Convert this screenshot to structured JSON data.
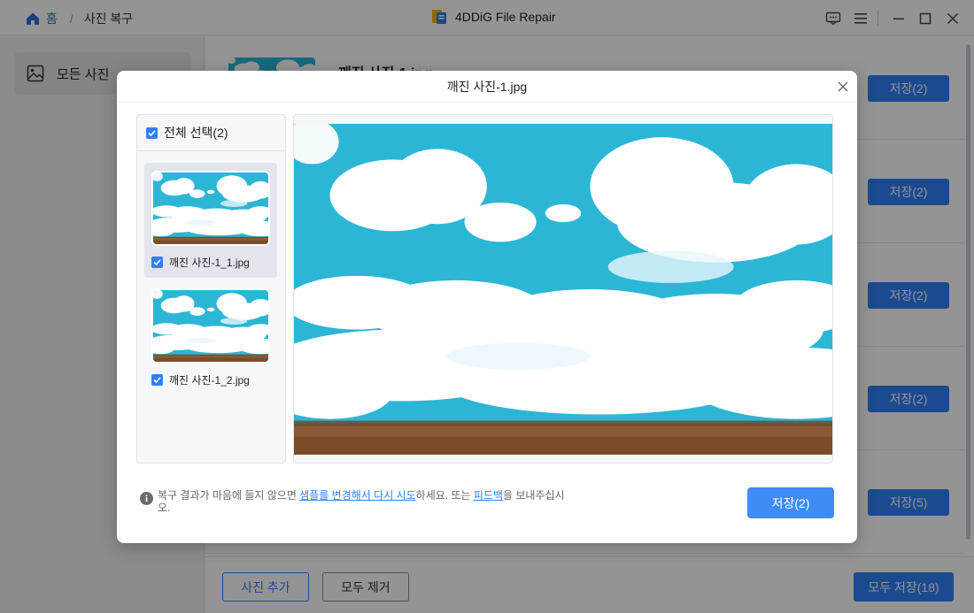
{
  "titlebar": {
    "home_label": "홈",
    "breadcrumb_current": "사진 복구",
    "app_title": "4DDiG File Repair"
  },
  "sidebar": {
    "items": [
      {
        "label": "모든 사진",
        "icon": "image-icon"
      }
    ]
  },
  "background_list": {
    "first_file_name": "깨진 사진-1.jpg",
    "save_buttons": [
      "저장(2)",
      "저장(2)",
      "저장(2)",
      "저장(2)",
      "저장(5)"
    ]
  },
  "bottom_bar": {
    "add_photo_label": "사진 추가",
    "remove_all_label": "모두 제거",
    "save_all_label": "모두 저장(18)"
  },
  "modal": {
    "title": "깨진 사진-1.jpg",
    "select_all_label": "전체 선택(2)",
    "files": [
      {
        "name": "깨진 사진-1_1.jpg",
        "checked": true,
        "selected": true
      },
      {
        "name": "깨진 사진-1_2.jpg",
        "checked": true,
        "selected": false
      }
    ],
    "info_text_1": "복구 결과가 마음에 들지 않으면 ",
    "info_link_1": "샘플를 변경해서 다시 시도",
    "info_text_2": "하세요. 또는 ",
    "info_link_2": "피드백",
    "info_text_3": "을 보내주십시오.",
    "save_label": "저장(2)"
  },
  "colors": {
    "accent": "#2f80f6",
    "sky": "#2cb6d6",
    "field": "#8a5a36"
  }
}
